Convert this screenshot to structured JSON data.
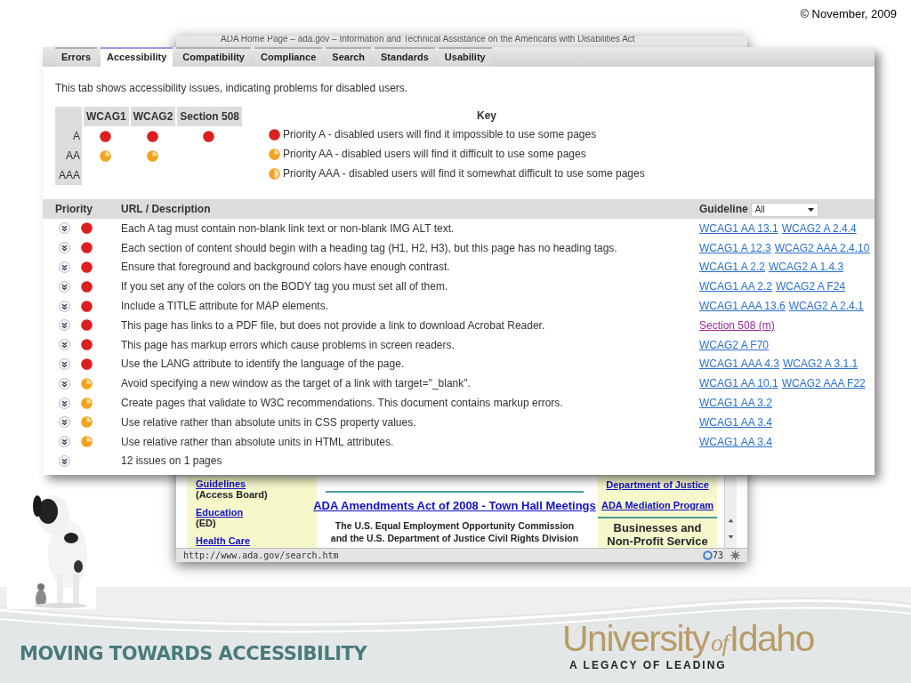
{
  "slide": {
    "date": "© November, 2009",
    "footer_title": "MOVING TOWARDS ACCESSIBILITY",
    "logo": [
      "University",
      "of",
      "Idaho"
    ],
    "tagline": "A LEGACY OF LEADING"
  },
  "browser": {
    "title": "ADA Home Page – ada.gov – Information and Technical Assistance on the Americans with Disabilities Act",
    "left_items": [
      {
        "link": "Guidelines",
        "note": "(Access Board)"
      },
      {
        "link": "Education",
        "note": "(ED)"
      },
      {
        "link": "Health Care"
      }
    ],
    "headline": "ADA Amendments Act of 2008 - Town Hall Meetings",
    "body_lines": [
      "The U.S. Equal Employment Opportunity Commission",
      "and the U.S. Department of Justice Civil Rights Division"
    ],
    "right_links": [
      "Department of Justice",
      "ADA Mediation Program"
    ],
    "right_heading": [
      "Businesses and",
      "Non-Profit Service"
    ],
    "status_url": "http://www.ada.gov/search.htm",
    "status_count": "73"
  },
  "report": {
    "tabs": [
      {
        "label": "Errors",
        "selected": false
      },
      {
        "label": "Accessibility",
        "selected": true
      },
      {
        "label": "Compatibility",
        "selected": false
      },
      {
        "label": "Compliance",
        "selected": false
      },
      {
        "label": "Search",
        "selected": false
      },
      {
        "label": "Standards",
        "selected": false
      },
      {
        "label": "Usability",
        "selected": false
      }
    ],
    "intro": "This tab shows accessibility issues, indicating problems for disabled users.",
    "summary": {
      "columns": [
        "WCAG1",
        "WCAG2",
        "Section 508"
      ],
      "rows": [
        {
          "label": "A",
          "cells": [
            {
              "kind": "high"
            },
            {
              "kind": "high"
            },
            {
              "kind": "high"
            }
          ]
        },
        {
          "label": "AA",
          "cells": [
            {
              "kind": "medium"
            },
            {
              "kind": "medium"
            },
            {
              "kind": "empty"
            }
          ]
        },
        {
          "label": "AAA",
          "cells": [
            {
              "kind": "empty"
            },
            {
              "kind": "empty"
            },
            {
              "kind": "empty"
            }
          ]
        }
      ]
    },
    "key": {
      "title": "Key",
      "items": [
        {
          "kind": "high",
          "text": "Priority A - disabled users will find it impossible to use some pages"
        },
        {
          "kind": "medium",
          "text": "Priority AA - disabled users will find it difficult to use some pages"
        },
        {
          "kind": "low",
          "text": "Priority AAA - disabled users will find it somewhat difficult to use some pages"
        }
      ]
    },
    "columns": [
      "Priority",
      "URL / Description",
      "Guideline"
    ],
    "guideline_filter": "All",
    "issues": [
      {
        "kind": "high",
        "text": "Each A tag must contain non-blank link text or non-blank IMG ALT text.",
        "links": [
          {
            "text": "WCAG1 AA 13.1",
            "visited": false
          },
          {
            "text": "WCAG2 A 2.4.4",
            "visited": false
          }
        ]
      },
      {
        "kind": "high",
        "text": "Each section of content should begin with a heading tag (H1, H2, H3), but this page has no heading tags.",
        "links": [
          {
            "text": "WCAG1 A 12.3",
            "visited": false
          },
          {
            "text": "WCAG2 AAA 2.4.10",
            "visited": false
          }
        ]
      },
      {
        "kind": "high",
        "text": "Ensure that foreground and background colors have enough contrast.",
        "links": [
          {
            "text": "WCAG1 A 2.2",
            "visited": false
          },
          {
            "text": "WCAG2 A 1.4.3",
            "visited": false
          }
        ]
      },
      {
        "kind": "high",
        "text": "If you set any of the colors on the BODY tag you must set all of them.",
        "links": [
          {
            "text": "WCAG1 AA 2.2",
            "visited": false
          },
          {
            "text": "WCAG2 A F24",
            "visited": false
          }
        ]
      },
      {
        "kind": "high",
        "text": "Include a TITLE attribute for MAP elements.",
        "links": [
          {
            "text": "WCAG1 AAA 13.6",
            "visited": false
          },
          {
            "text": "WCAG2 A 2.4.1",
            "visited": false
          }
        ]
      },
      {
        "kind": "high",
        "text": "This page has links to a PDF file, but does not provide a link to download Acrobat Reader.",
        "links": [
          {
            "text": "Section 508 (m)",
            "visited": true
          }
        ]
      },
      {
        "kind": "high",
        "text": "This page has markup errors which cause problems in screen readers.",
        "links": [
          {
            "text": "WCAG2 A F70",
            "visited": false
          }
        ]
      },
      {
        "kind": "high",
        "text": "Use the LANG attribute to identify the language of the page.",
        "links": [
          {
            "text": "WCAG1 AAA 4.3",
            "visited": false
          },
          {
            "text": "WCAG2 A 3.1.1",
            "visited": false
          }
        ]
      },
      {
        "kind": "medium",
        "text": "Avoid specifying a new window as the target of a link with target=\"_blank\".",
        "links": [
          {
            "text": "WCAG1 AA 10.1",
            "visited": false
          },
          {
            "text": "WCAG2 AAA F22",
            "visited": false
          }
        ]
      },
      {
        "kind": "medium",
        "text": "Create pages that validate to W3C recommendations. This document contains markup errors.",
        "links": [
          {
            "text": "WCAG1 AA 3.2",
            "visited": false
          }
        ]
      },
      {
        "kind": "medium",
        "text": "Use relative rather than absolute units in CSS property values.",
        "links": [
          {
            "text": "WCAG1 AA 3.4",
            "visited": false
          }
        ]
      },
      {
        "kind": "medium",
        "text": "Use relative rather than absolute units in HTML attributes.",
        "links": [
          {
            "text": "WCAG1 AA 3.4",
            "visited": false
          }
        ]
      }
    ],
    "total": "12 issues on 1 pages"
  }
}
